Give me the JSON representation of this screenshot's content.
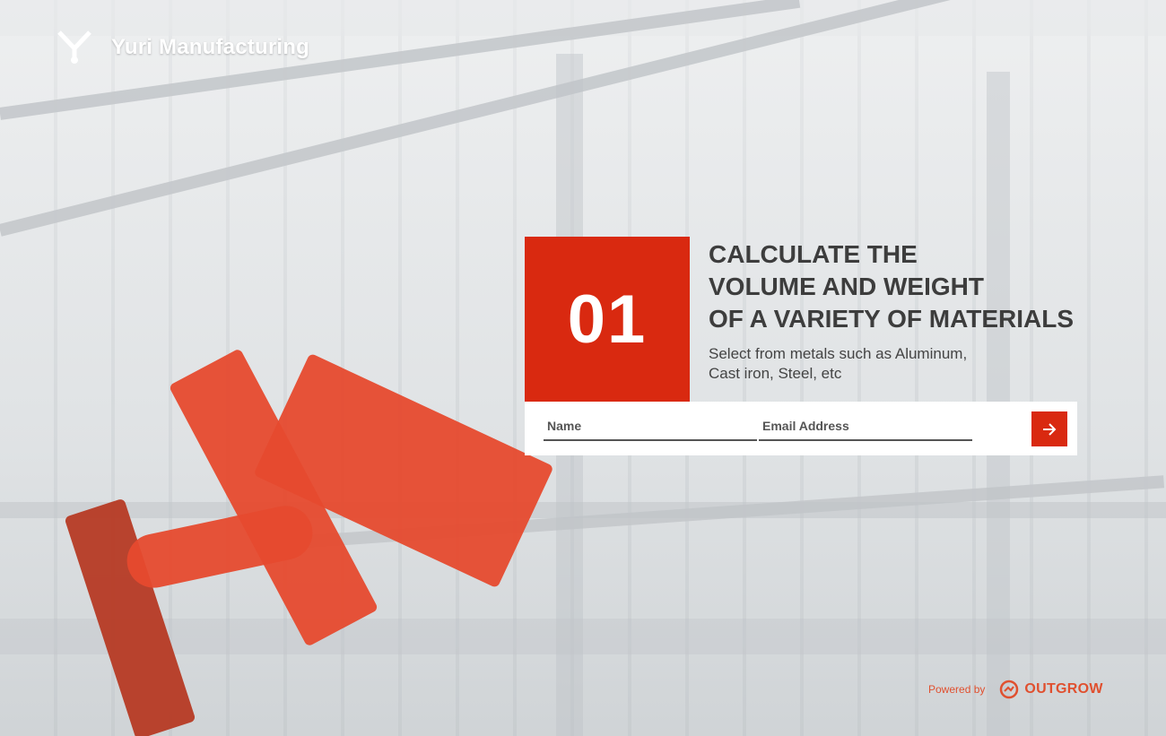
{
  "brand": {
    "name": "Yuri Manufacturing"
  },
  "hero": {
    "number": "01",
    "headline_lines": [
      "CALCULATE THE",
      "VOLUME AND WEIGHT",
      "OF A VARIETY OF MATERIALS"
    ],
    "subtitle_lines": [
      "Select from metals such as Aluminum,",
      "Cast iron, Steel, etc"
    ]
  },
  "form": {
    "name_placeholder": "Name",
    "email_placeholder": "Email Address",
    "submit_icon": "arrow-right-icon"
  },
  "footer": {
    "powered_by": "Powered by",
    "provider": "OUTGROW"
  },
  "colors": {
    "accent": "#d92910",
    "headline": "#3d3d3d",
    "powered": "#e0502f"
  }
}
